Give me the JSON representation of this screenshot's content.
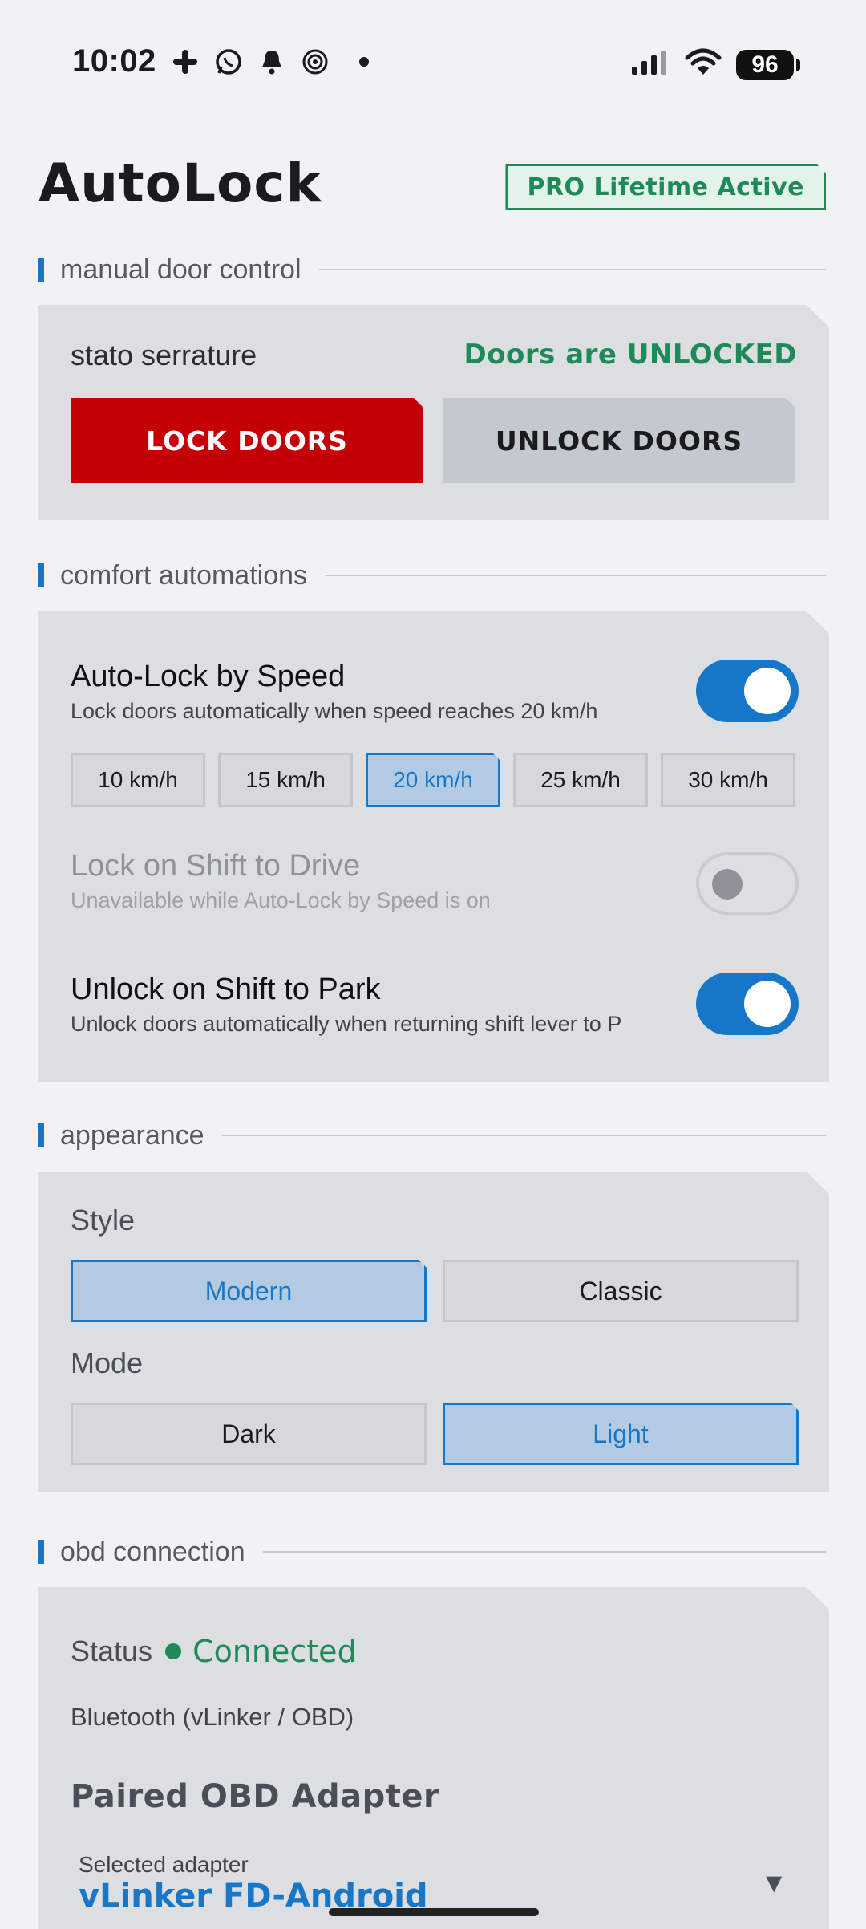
{
  "status_bar": {
    "time": "10:02",
    "battery": "96",
    "icons_left": [
      "slack-icon",
      "whatsapp-icon",
      "bell-icon",
      "radar-icon"
    ],
    "icons_right": [
      "signal-icon",
      "wifi-icon",
      "battery-icon"
    ]
  },
  "header": {
    "title": "AutoLock",
    "badge": "PRO Lifetime Active"
  },
  "sections": {
    "manual": "manual door control",
    "comfort": "comfort automations",
    "appearance": "appearance",
    "obd": "obd connection"
  },
  "manual": {
    "status_label": "stato serrature",
    "status_value": "Doors are UNLOCKED",
    "lock_button": "LOCK DOORS",
    "unlock_button": "UNLOCK DOORS",
    "colors": {
      "lock": "#c40006",
      "status": "#1e8a57"
    }
  },
  "comfort": {
    "speed": {
      "title": "Auto-Lock by Speed",
      "subtitle": "Lock doors automatically when speed reaches 20 km/h",
      "enabled": true,
      "options": [
        "10 km/h",
        "15 km/h",
        "20 km/h",
        "25 km/h",
        "30 km/h"
      ],
      "selected": "20 km/h"
    },
    "drive": {
      "title": "Lock on Shift to Drive",
      "subtitle": "Unavailable while Auto-Lock by Speed is on",
      "enabled": false,
      "disabled": true
    },
    "park": {
      "title": "Unlock on Shift to Park",
      "subtitle": "Unlock doors automatically when returning shift lever to P",
      "enabled": true
    }
  },
  "appearance": {
    "style_label": "Style",
    "style_options": [
      "Modern",
      "Classic"
    ],
    "style_selected": "Modern",
    "mode_label": "Mode",
    "mode_options": [
      "Dark",
      "Light"
    ],
    "mode_selected": "Light"
  },
  "obd": {
    "status_label": "Status",
    "status_value": "Connected",
    "transport": "Bluetooth (vLinker / OBD)",
    "paired_title": "Paired OBD Adapter",
    "selected_label": "Selected adapter",
    "selected_value": "vLinker FD-Android"
  },
  "theme": {
    "accent": "#1677c8",
    "success": "#1e8a57",
    "danger": "#c40006"
  }
}
